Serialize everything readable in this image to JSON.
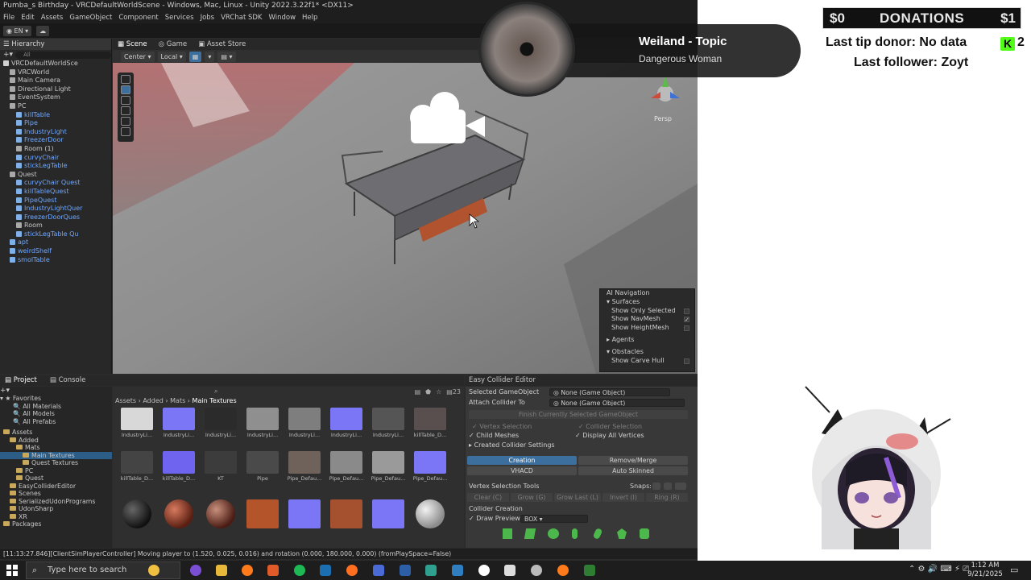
{
  "window": {
    "title": "Pumba_s Birthday - VRCDefaultWorldScene - Windows, Mac, Linux - Unity 2022.3.22f1* <DX11>"
  },
  "menu": [
    "File",
    "Edit",
    "Assets",
    "GameObject",
    "Component",
    "Services",
    "Jobs",
    "VRChat SDK",
    "Window",
    "Help"
  ],
  "toolbar": {
    "account": "EN"
  },
  "hierarchy": {
    "tab": "Hierarchy",
    "search_placeholder": "All",
    "items": [
      {
        "label": "VRCDefaultWorldSce",
        "indent": 0,
        "kind": "root"
      },
      {
        "label": "VRCWorld",
        "indent": 1,
        "kind": "grey"
      },
      {
        "label": "Main Camera",
        "indent": 1,
        "kind": "grey"
      },
      {
        "label": "Directional Light",
        "indent": 1,
        "kind": "grey"
      },
      {
        "label": "EventSystem",
        "indent": 1,
        "kind": "grey"
      },
      {
        "label": "PC",
        "indent": 1,
        "kind": "grey"
      },
      {
        "label": "killTable",
        "indent": 2,
        "kind": "blue"
      },
      {
        "label": "Pipe",
        "indent": 2,
        "kind": "blue"
      },
      {
        "label": "IndustryLight",
        "indent": 2,
        "kind": "blue"
      },
      {
        "label": "FreezerDoor",
        "indent": 2,
        "kind": "blue"
      },
      {
        "label": "Room (1)",
        "indent": 2,
        "kind": "grey"
      },
      {
        "label": "curvyChair",
        "indent": 2,
        "kind": "blue"
      },
      {
        "label": "stickLegTable",
        "indent": 2,
        "kind": "blue"
      },
      {
        "label": "Quest",
        "indent": 1,
        "kind": "grey"
      },
      {
        "label": "curvyChair Quest",
        "indent": 2,
        "kind": "blue"
      },
      {
        "label": "killTableQuest",
        "indent": 2,
        "kind": "blue"
      },
      {
        "label": "PipeQuest",
        "indent": 2,
        "kind": "blue"
      },
      {
        "label": "IndustryLightQuer",
        "indent": 2,
        "kind": "blue"
      },
      {
        "label": "FreezerDoorQues",
        "indent": 2,
        "kind": "blue"
      },
      {
        "label": "Room",
        "indent": 2,
        "kind": "grey"
      },
      {
        "label": "stickLegTable Qu",
        "indent": 2,
        "kind": "blue"
      },
      {
        "label": "apt",
        "indent": 1,
        "kind": "blue"
      },
      {
        "label": "weirdShelf",
        "indent": 1,
        "kind": "blue"
      },
      {
        "label": "smolTable",
        "indent": 1,
        "kind": "blue"
      }
    ]
  },
  "scene": {
    "tabs": [
      "Scene",
      "Game",
      "Asset Store"
    ],
    "pivot": "Center",
    "space": "Local",
    "persp_label": "Persp"
  },
  "ai_navigation": {
    "title": "AI Navigation",
    "surfaces_label": "Surfaces",
    "options": [
      {
        "label": "Show Only Selected",
        "checked": false
      },
      {
        "label": "Show NavMesh",
        "checked": true
      },
      {
        "label": "Show HeightMesh",
        "checked": false
      }
    ],
    "agents_label": "Agents",
    "obstacles_label": "Obstacles",
    "carve_label": "Show Carve Hull"
  },
  "project": {
    "tabs": [
      "Project",
      "Console"
    ],
    "favorites": [
      "Favorites",
      "All Materials",
      "All Models",
      "All Prefabs"
    ],
    "tree": [
      {
        "label": "Assets",
        "indent": 0,
        "sel": false
      },
      {
        "label": "Added",
        "indent": 1,
        "sel": false
      },
      {
        "label": "Mats",
        "indent": 2,
        "sel": false
      },
      {
        "label": "Main Textures",
        "indent": 3,
        "sel": true
      },
      {
        "label": "Quest Textures",
        "indent": 3,
        "sel": false
      },
      {
        "label": "PC",
        "indent": 2,
        "sel": false
      },
      {
        "label": "Quest",
        "indent": 2,
        "sel": false
      },
      {
        "label": "EasyColliderEditor",
        "indent": 1,
        "sel": false
      },
      {
        "label": "Scenes",
        "indent": 1,
        "sel": false
      },
      {
        "label": "SerializedUdonPrograms",
        "indent": 1,
        "sel": false
      },
      {
        "label": "UdonSharp",
        "indent": 1,
        "sel": false
      },
      {
        "label": "XR",
        "indent": 1,
        "sel": false
      },
      {
        "label": "Packages",
        "indent": 0,
        "sel": false
      }
    ],
    "breadcrumb": [
      "Assets",
      "Added",
      "Mats",
      "Main Textures"
    ],
    "item_count": "23",
    "thumbs_row1": [
      {
        "cap": "IndustryLi...",
        "color": "#d8d8d8"
      },
      {
        "cap": "IndustryLi...",
        "color": "#7b76f5"
      },
      {
        "cap": "IndustryLi...",
        "color": "#2b2b2b"
      },
      {
        "cap": "IndustryLi...",
        "color": "#8f8f8f"
      },
      {
        "cap": "IndustryLi...",
        "color": "#7e7e7e"
      },
      {
        "cap": "IndustryLi...",
        "color": "#7b76f5"
      },
      {
        "cap": "IndustryLi...",
        "color": "#555555"
      },
      {
        "cap": "killTable_D...",
        "color": "#5a4f4f"
      }
    ],
    "thumbs_row2": [
      {
        "cap": "killTable_D...",
        "color": "#444444"
      },
      {
        "cap": "killTable_D...",
        "color": "#6e64f0"
      },
      {
        "cap": "KT",
        "color": "#3c3c3c"
      },
      {
        "cap": "Pipe",
        "color": "#4a4a4a"
      },
      {
        "cap": "Pipe_Defau...",
        "color": "#6e625a"
      },
      {
        "cap": "Pipe_Defau...",
        "color": "#8a8a8a"
      },
      {
        "cap": "Pipe_Defau...",
        "color": "#9a9a9a"
      },
      {
        "cap": "Pipe_Defau...",
        "color": "#7b76f5"
      }
    ]
  },
  "collider_editor": {
    "tab": "Easy Collider Editor",
    "selected_label": "Selected GameObject",
    "selected_value": "None (Game Object)",
    "attach_label": "Attach Collider To",
    "attach_value": "None (Game Object)",
    "finish_button": "Finish Currently Selected GameObject",
    "vertex_selection": "Vertex Selection",
    "collider_selection": "Collider Selection",
    "child_meshes": "Child Meshes",
    "display_all_vertices": "Display All Vertices",
    "created_settings": "Created Collider Settings",
    "creation": "Creation",
    "remove_merge": "Remove/Merge",
    "vhacd": "VHACD",
    "auto_skinned": "Auto Skinned",
    "vertex_tools": "Vertex Selection Tools",
    "snaps": "Snaps:",
    "tool_buttons": [
      "Clear (C)",
      "Grow (G)",
      "Grow Last (L)",
      "Invert (I)",
      "Ring (R)"
    ],
    "collider_creation": "Collider Creation",
    "draw_preview_label": "Draw Preview:",
    "draw_preview_value": "BOX"
  },
  "status_bar": {
    "message": "[11:13:27.846][ClientSimPlayerController] Moving player to (1.520, 0.025, 0.016) and rotation (0.000, 180.000, 0.000) (fromPlaySpace=False)"
  },
  "stream_overlay": {
    "donation_left": "$0",
    "donation_title": "DONATIONS",
    "donation_right": "$1",
    "tip_donor": "Last tip donor: No data",
    "kick_icon": "K",
    "kick_count": "2",
    "follower": "Last follower: Zoyt",
    "song_title": "Weiland - Topic",
    "song_artist": "Dangerous Woman"
  },
  "taskbar": {
    "search_placeholder": "Type here to search",
    "time": "1:12 AM",
    "date": "9/21/2025"
  },
  "colors": {
    "unity_bg": "#2b2b2b",
    "selection_blue": "#3d6f9e",
    "prefab_blue": "#6fa8ff",
    "kick_green": "#53fc18"
  }
}
